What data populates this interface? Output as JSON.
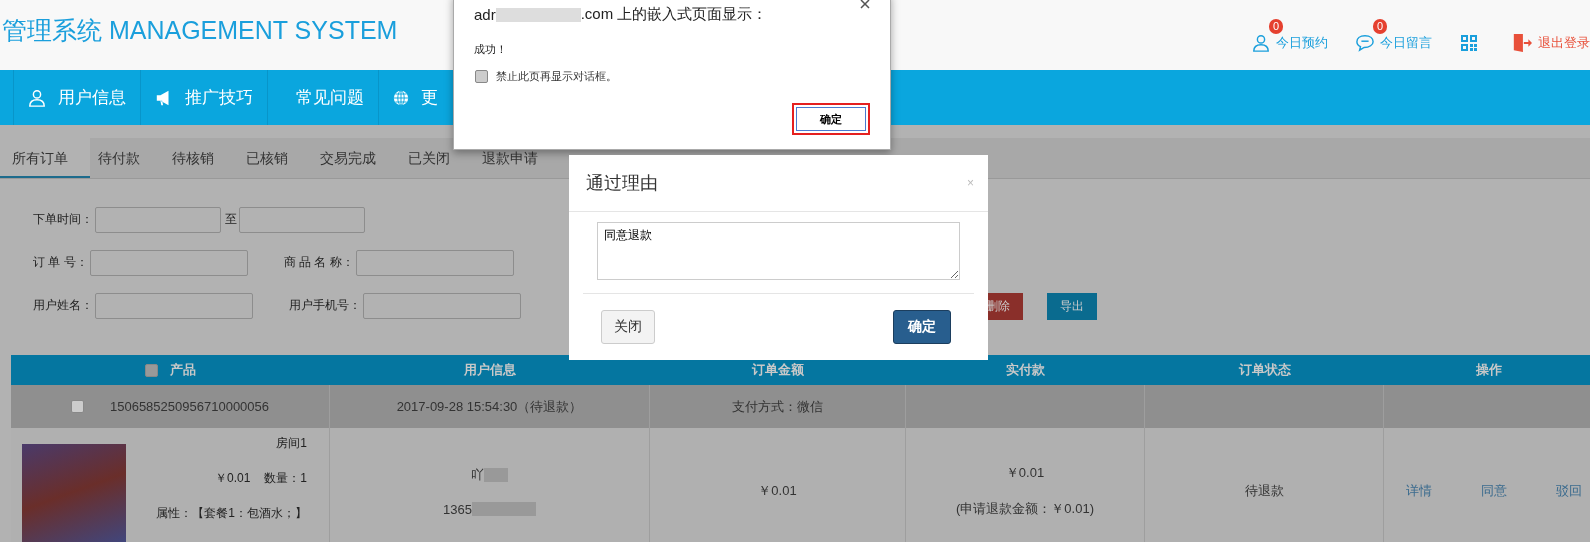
{
  "header": {
    "title": "管理系统 MANAGEMENT SYSTEM",
    "links": [
      {
        "label": "今日预约",
        "badge": "0"
      },
      {
        "label": "今日留言",
        "badge": "0"
      },
      {
        "label": "退出登录"
      }
    ]
  },
  "nav": [
    {
      "label": "用户信息"
    },
    {
      "label": "推广技巧"
    },
    {
      "label": "常见问题"
    },
    {
      "label": "更"
    }
  ],
  "tabs": [
    {
      "label": "所有订单",
      "selected": true
    },
    {
      "label": "待付款",
      "selected": false
    },
    {
      "label": "待核销",
      "selected": false
    },
    {
      "label": "已核销",
      "selected": false
    },
    {
      "label": "交易完成",
      "selected": false
    },
    {
      "label": "已关闭",
      "selected": false
    },
    {
      "label": "退款申请",
      "selected": false
    }
  ],
  "filters": [
    [
      {
        "label": "下单时间："
      },
      {
        "label": "至"
      }
    ],
    [
      {
        "label": "订 单 号："
      },
      {
        "label": "商 品 名 称："
      }
    ],
    [
      {
        "label": "用户姓名："
      },
      {
        "label": "用户手机号："
      }
    ]
  ],
  "actions": [
    {
      "label": "删除",
      "kind": "danger"
    },
    {
      "label": "导出",
      "kind": "primary"
    }
  ],
  "table": {
    "select_all_checked": false,
    "columns": [
      "产品",
      "用户信息",
      "订单金额",
      "实付款",
      "订单状态",
      "操作"
    ],
    "order": {
      "checked": false,
      "number": "1506585250956710000056",
      "time": "2017-09-28 15:54:30（待退款）",
      "payment": "支付方式：微信"
    },
    "item": {
      "name": "房间1",
      "price": "￥0.01",
      "quantity": "数量：1",
      "attributes": "属性：【套餐1：包酒水；】",
      "user_name": "吖",
      "user_phone": "1365",
      "amount": "￥0.01",
      "paid": "￥0.01",
      "refund_note": "(申请退款金额：￥0.01)",
      "status": "待退款",
      "operations": [
        "详情",
        "同意",
        "驳回"
      ]
    }
  },
  "alert": {
    "title_start": "adr",
    "title_end": ".com 上的嵌入式页面显示：",
    "message": "成功！",
    "checkbox": {
      "label": "禁止此页再显示对话框。",
      "checked": false
    },
    "button": "确定"
  },
  "modal": {
    "title": "通过理由",
    "close": "×",
    "reason": "同意退款",
    "buttons": [
      {
        "label": "关闭",
        "kind": "default"
      },
      {
        "label": "确定",
        "kind": "primary"
      }
    ]
  }
}
